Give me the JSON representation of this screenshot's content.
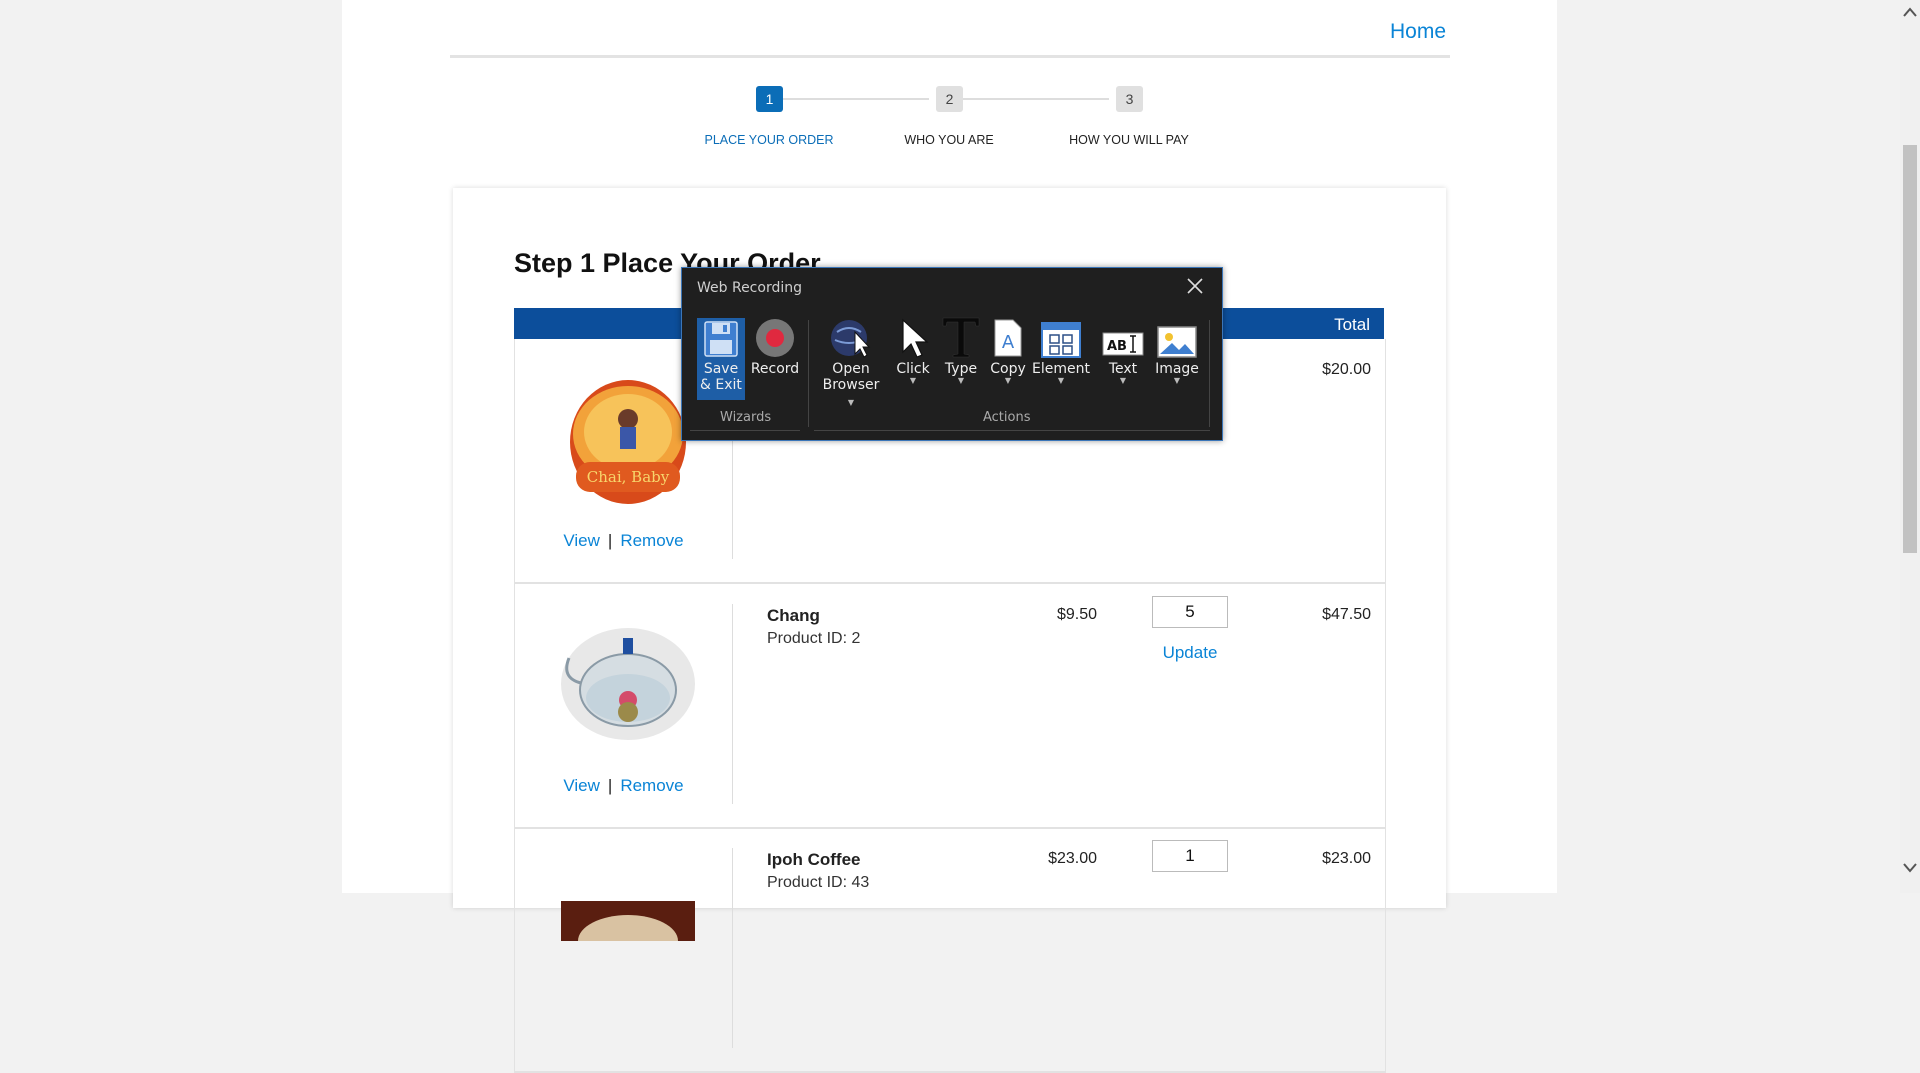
{
  "header": {
    "home_label": "Home"
  },
  "steps": [
    {
      "number": "1",
      "label": "PLACE YOUR ORDER",
      "active": true
    },
    {
      "number": "2",
      "label": "WHO YOU ARE",
      "active": false
    },
    {
      "number": "3",
      "label": "HOW YOU WILL PAY",
      "active": false
    }
  ],
  "order": {
    "title": "Step 1 Place Your Order",
    "table_header_total": "Total",
    "view_label": "View",
    "remove_label": "Remove",
    "update_label": "Update",
    "divider": "|",
    "items": [
      {
        "name": "",
        "product_id": "",
        "price": "",
        "quantity": "",
        "total": "$20.00",
        "image": "chai-tin-image"
      },
      {
        "name": "Chang",
        "product_id": "Product ID: 2",
        "price": "$9.50",
        "quantity": "5",
        "total": "$47.50",
        "image": "glass-teapot-image"
      },
      {
        "name": "Ipoh Coffee",
        "product_id": "Product ID: 43",
        "price": "$23.00",
        "quantity": "1",
        "total": "$23.00",
        "image": "coffee-cup-image"
      }
    ]
  },
  "recording_dialog": {
    "title": "Web Recording",
    "wizards_group": "Wizards",
    "actions_group": "Actions",
    "tools": {
      "save_exit_line1": "Save",
      "save_exit_line2": "& Exit",
      "record": "Record",
      "open_browser_line1": "Open",
      "open_browser_line2": "Browser",
      "click": "Click",
      "type": "Type",
      "copy": "Copy",
      "element": "Element",
      "text": "Text",
      "image": "Image"
    }
  },
  "colors": {
    "accent": "#0b6db7",
    "link": "#0a84d6",
    "table_header": "#0c4e9b",
    "dialog_bg": "#1f1f1f",
    "record_red": "#e0293f"
  }
}
